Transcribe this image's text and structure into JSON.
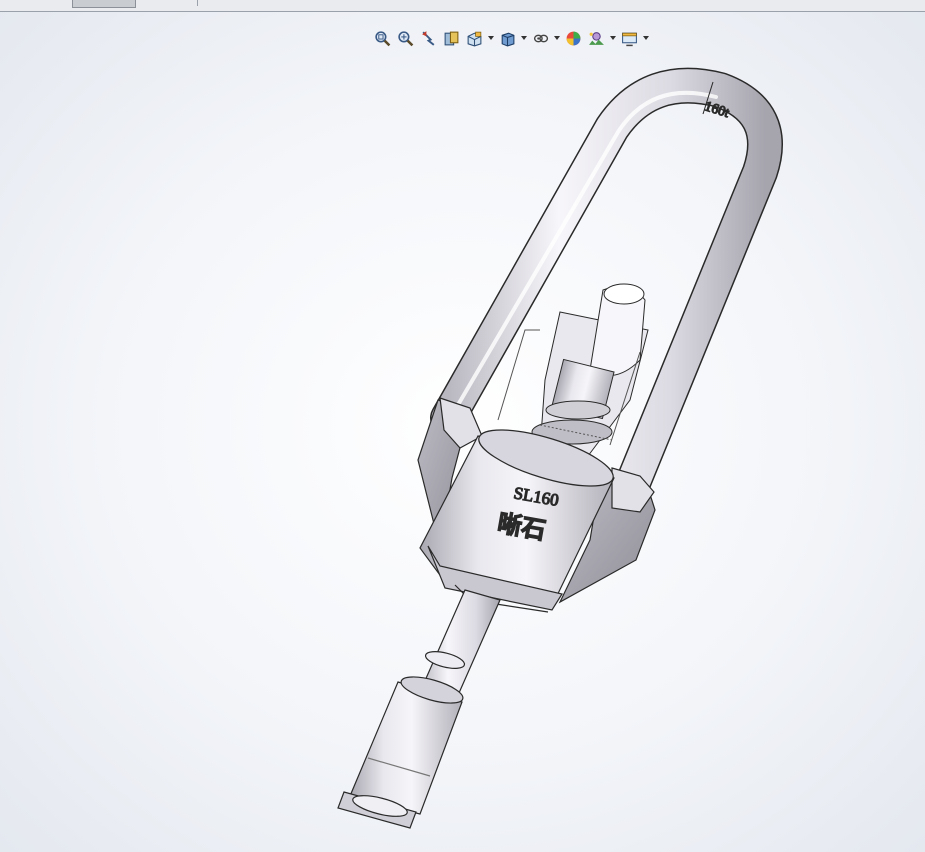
{
  "window": {
    "document_tab": {
      "active": true
    }
  },
  "view_toolbar": {
    "buttons": [
      {
        "icon": "zoom-to-fit-icon",
        "has_dropdown": false
      },
      {
        "icon": "zoom-to-area-icon",
        "has_dropdown": false
      },
      {
        "icon": "previous-view-icon",
        "has_dropdown": false
      },
      {
        "icon": "section-view-icon",
        "has_dropdown": false
      },
      {
        "icon": "view-orientation-icon",
        "has_dropdown": true
      },
      {
        "icon": "display-style-icon",
        "has_dropdown": true
      },
      {
        "icon": "hide-show-items-icon",
        "has_dropdown": true
      },
      {
        "icon": "edit-appearance-icon",
        "has_dropdown": false
      },
      {
        "icon": "apply-scene-icon",
        "has_dropdown": true
      },
      {
        "icon": "view-settings-icon",
        "has_dropdown": true
      }
    ]
  },
  "model": {
    "bail_label": "160t",
    "body_label_model": "SL160",
    "body_label_brand": "晰石"
  },
  "colors": {
    "background_center": "#ffffff",
    "background_edge": "#e4e8ef",
    "part_light": "#f4f3f8",
    "part_mid": "#d9d7df",
    "part_dark": "#a9a7b0",
    "outline": "#2a2a2a"
  }
}
